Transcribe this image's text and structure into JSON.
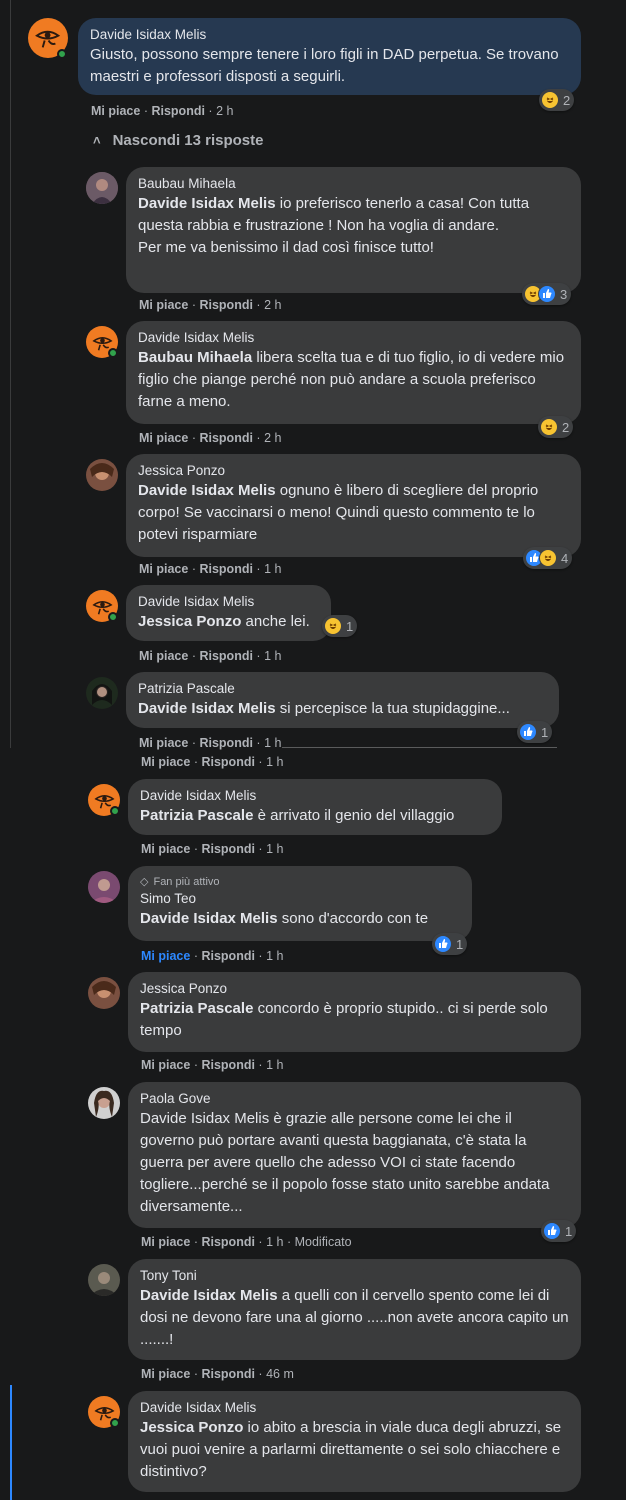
{
  "toggle_label": "Nascondi 13 risposte",
  "like_label": "Mi piace",
  "reply_label": "Rispondi",
  "separator": "·",
  "main": {
    "author": "Davide Isidax Melis",
    "text": "Giusto, possono sempre tenere i loro figli in DAD perpetua. Se trovano maestri e professori disposti a seguirli.",
    "time": "2 h",
    "reaction_count": "2"
  },
  "replies": [
    {
      "author": "Baubau Mihaela",
      "mention": "Davide Isidax Melis",
      "text": " io preferisco tenerlo a casa! Con tutta questa rabbia e frustrazione ! Non ha voglia di andare.",
      "text2": "Per me va benissimo il dad così finisce tutto!",
      "time": "2 h",
      "reaction_count": "3"
    },
    {
      "author": "Davide Isidax Melis",
      "mention": "Baubau Mihaela",
      "text": " libera scelta tua e di tuo figlio, io di vedere mio figlio che piange perché non può andare a scuola preferisco farne a meno.",
      "time": "2 h",
      "reaction_count": "2"
    },
    {
      "author": "Jessica Ponzo",
      "mention": "Davide Isidax Melis",
      "text": " ognuno è libero di scegliere del proprio corpo! Se vaccinarsi o meno! Quindi questo commento te lo potevi risparmiare",
      "time": "1 h",
      "reaction_count": "4"
    },
    {
      "author": "Davide Isidax Melis",
      "mention": "Jessica Ponzo",
      "text": " anche lei.",
      "time": "1 h",
      "reaction_count": "1"
    },
    {
      "author": "Patrizia Pascale",
      "mention": "Davide Isidax Melis",
      "text": " si percepisce la tua stupidaggine...",
      "time": "1 h",
      "reaction_count": "1"
    },
    {
      "author": "Davide Isidax Melis",
      "mention": "Patrizia Pascale",
      "text": " è arrivato il genio del villaggio",
      "time": "1 h"
    },
    {
      "badge": "Fan più attivo",
      "author": "Simo Teo",
      "mention": "Davide Isidax Melis",
      "text": " sono d'accordo con te",
      "time": "1 h",
      "reaction_count": "1"
    },
    {
      "author": "Jessica Ponzo",
      "mention": "Patrizia Pascale",
      "text": " concordo è proprio stupido.. ci si perde solo tempo",
      "time": "1 h"
    },
    {
      "author": "Paola Gove",
      "text": "Davide Isidax Melis è grazie alle persone come lei che il governo può portare avanti questa baggianata, c'è stata la guerra per avere quello che adesso VOI ci state facendo togliere...perché se il popolo fosse stato unito sarebbe andata diversamente...",
      "time": "1 h",
      "edited": "Modificato",
      "reaction_count": "1"
    },
    {
      "author": "Tony Toni",
      "mention": "Davide Isidax Melis",
      "text": " a quelli con il cervello spento come lei di dosi ne devono fare una al giorno .....non avete ancora capito un .......!",
      "time": "46 m"
    },
    {
      "author": "Davide Isidax Melis",
      "mention": "Jessica Ponzo",
      "text": " io abito a brescia in viale duca degli abruzzi, se vuoi puoi venire a parlarmi direttamente o sei solo chiacchere e distintivo?"
    }
  ],
  "icons": {
    "avatar_logo": "eye-of-horus-logo",
    "haha": "haha-emoji-icon",
    "like": "like-thumb-icon",
    "chevron": "chevron-up-icon",
    "badge": "diamond-icon"
  },
  "colors": {
    "background": "#18191a",
    "bubble": "#3a3b3c",
    "bubble_selected": "#263951",
    "accent": "#2d88ff",
    "online": "#31a24c",
    "logo": "#f07b22"
  }
}
